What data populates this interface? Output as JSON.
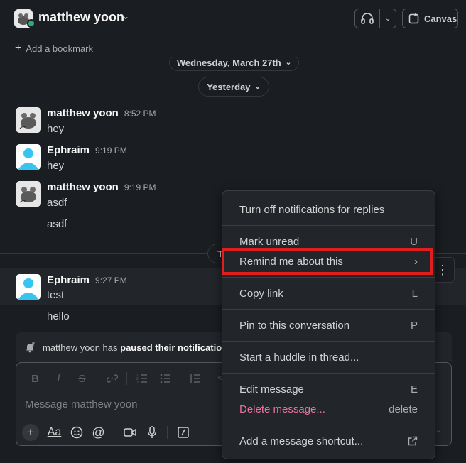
{
  "header": {
    "user_name": "matthew yoon",
    "canvas_label": "Canvas",
    "bookmark_label": "Add a bookmark"
  },
  "dates": {
    "top": "Wednesday, March 27th",
    "yesterday": "Yesterday"
  },
  "messages": [
    {
      "author": "matthew yoon",
      "time": "8:52 PM",
      "lines": [
        "hey"
      ]
    },
    {
      "author": "Ephraim",
      "time": "9:19 PM",
      "lines": [
        "hey"
      ]
    },
    {
      "author": "matthew yoon",
      "time": "9:19 PM",
      "lines": [
        "asdf",
        "asdf"
      ]
    },
    {
      "author": "Ephraim",
      "time": "9:27 PM",
      "lines": [
        "test",
        "hello"
      ]
    }
  ],
  "notification": {
    "prefix": "matthew yoon has ",
    "bold": "paused their notifications"
  },
  "composer": {
    "placeholder": "Message matthew yoon"
  },
  "context_menu": {
    "items": [
      {
        "label": "Turn off notifications for replies",
        "shortcut": ""
      },
      {
        "label": "Mark unread",
        "shortcut": "U"
      },
      {
        "label": "Remind me about this",
        "shortcut": "›"
      },
      {
        "label": "Copy link",
        "shortcut": "L"
      },
      {
        "label": "Pin to this conversation",
        "shortcut": "P"
      },
      {
        "label": "Start a huddle in thread...",
        "shortcut": ""
      },
      {
        "label": "Edit message",
        "shortcut": "E"
      },
      {
        "label": "Delete message...",
        "shortcut": "delete"
      },
      {
        "label": "Add a message shortcut...",
        "shortcut": ""
      }
    ]
  },
  "colors": {
    "background": "#1a1d21",
    "danger": "#e8729a",
    "highlight": "#e01e1e",
    "presence": "#2bac76"
  }
}
